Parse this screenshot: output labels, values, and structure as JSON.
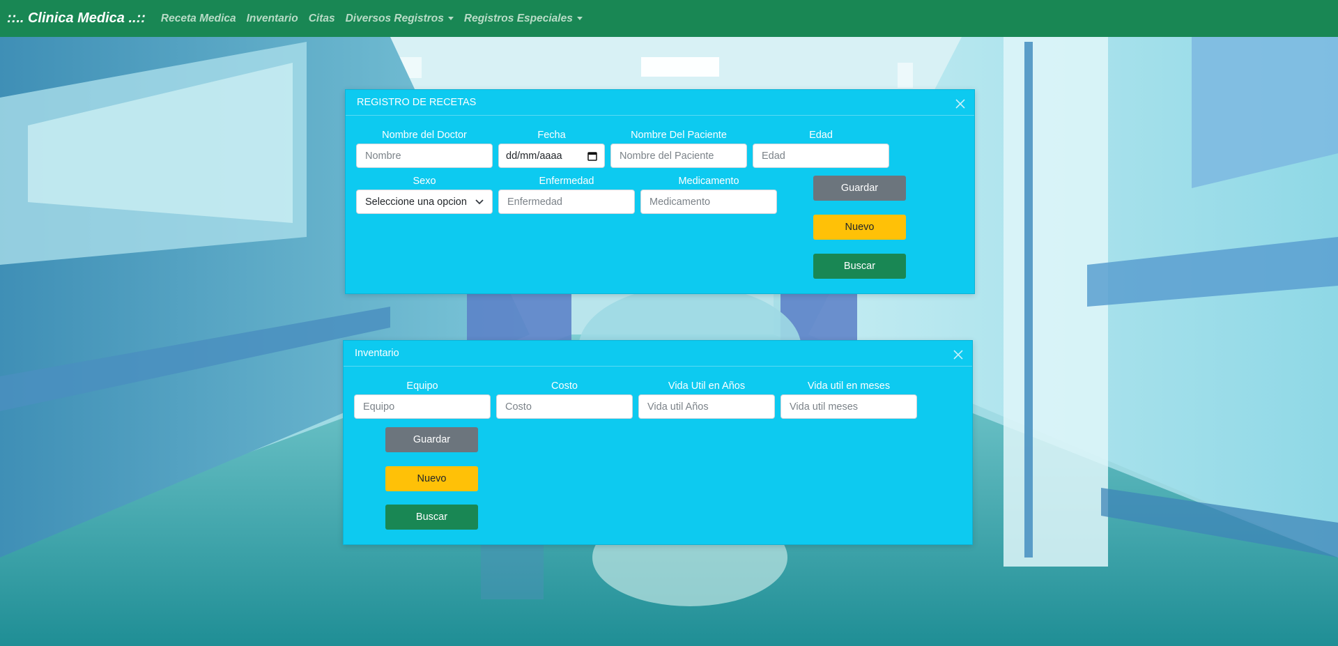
{
  "colors": {
    "navbar": "#198754",
    "panel": "#0dcaf0",
    "btn_secondary": "#6c757d",
    "btn_warning": "#ffc107",
    "btn_success": "#198754"
  },
  "navbar": {
    "brand": "::.. Clinica Medica ..::",
    "links": [
      {
        "label": "Receta Medica"
      },
      {
        "label": "Inventario"
      },
      {
        "label": "Citas"
      },
      {
        "label": "Diversos Registros",
        "dropdown": true
      },
      {
        "label": "Registros Especiales",
        "dropdown": true
      }
    ]
  },
  "recetas": {
    "title": "REGISTRO DE RECETAS",
    "close_icon": "close-icon",
    "fields": {
      "doctor": {
        "label": "Nombre del Doctor",
        "placeholder": "Nombre",
        "value": ""
      },
      "fecha": {
        "label": "Fecha",
        "value": "dd/mm/aaaa",
        "icon": "calendar-icon"
      },
      "paciente": {
        "label": "Nombre Del Paciente",
        "placeholder": "Nombre del Paciente",
        "value": ""
      },
      "edad": {
        "label": "Edad",
        "placeholder": "Edad",
        "value": ""
      },
      "sexo": {
        "label": "Sexo",
        "selected": "Seleccione una opcion",
        "icon": "chevron-down-icon"
      },
      "enfermedad": {
        "label": "Enfermedad",
        "placeholder": "Enfermedad",
        "value": ""
      },
      "medicamento": {
        "label": "Medicamento",
        "placeholder": "Medicamento",
        "value": ""
      }
    },
    "buttons": {
      "guardar": "Guardar",
      "nuevo": "Nuevo",
      "buscar": "Buscar"
    }
  },
  "inventario": {
    "title": "Inventario",
    "close_icon": "close-icon",
    "fields": {
      "equipo": {
        "label": "Equipo",
        "placeholder": "Equipo",
        "value": ""
      },
      "costo": {
        "label": "Costo",
        "placeholder": "Costo",
        "value": ""
      },
      "vida_anios": {
        "label": "Vida Util en Años",
        "placeholder": "Vida util Años",
        "value": ""
      },
      "vida_meses": {
        "label": "Vida util en meses",
        "placeholder": "Vida util meses",
        "value": ""
      }
    },
    "buttons": {
      "guardar": "Guardar",
      "nuevo": "Nuevo",
      "buscar": "Buscar"
    }
  }
}
